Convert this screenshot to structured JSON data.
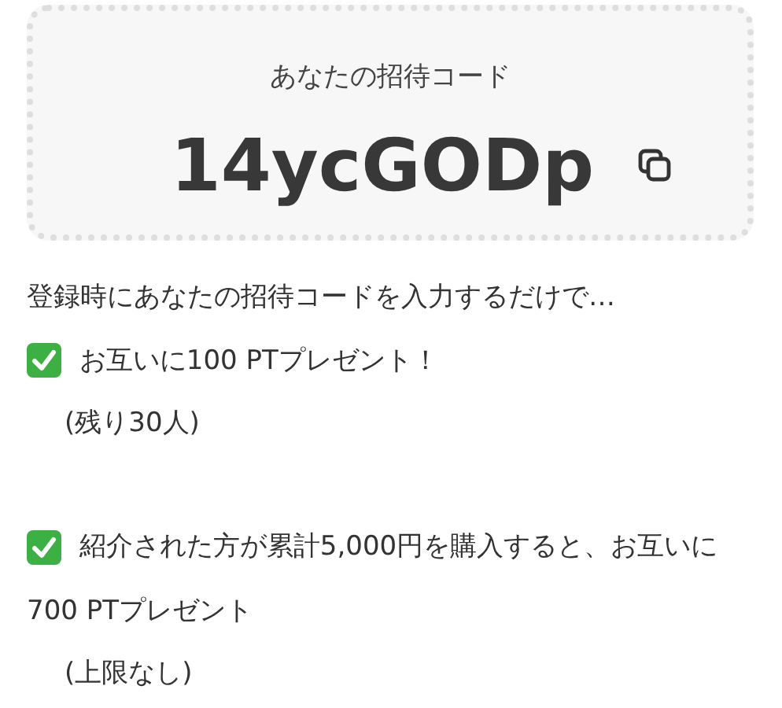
{
  "invite_card": {
    "label": "あなたの招待コード",
    "code": "14ycGODp"
  },
  "intro": "登録時にあなたの招待コードを入力するだけで…",
  "benefits": [
    {
      "checked": true,
      "text": "お互いに100 PTプレゼント！",
      "note": "(残り30人)"
    },
    {
      "checked": true,
      "text": "紹介された方が累計5,000円を購入すると、お互いに700 PTプレゼント",
      "note": "(上限なし)"
    }
  ]
}
